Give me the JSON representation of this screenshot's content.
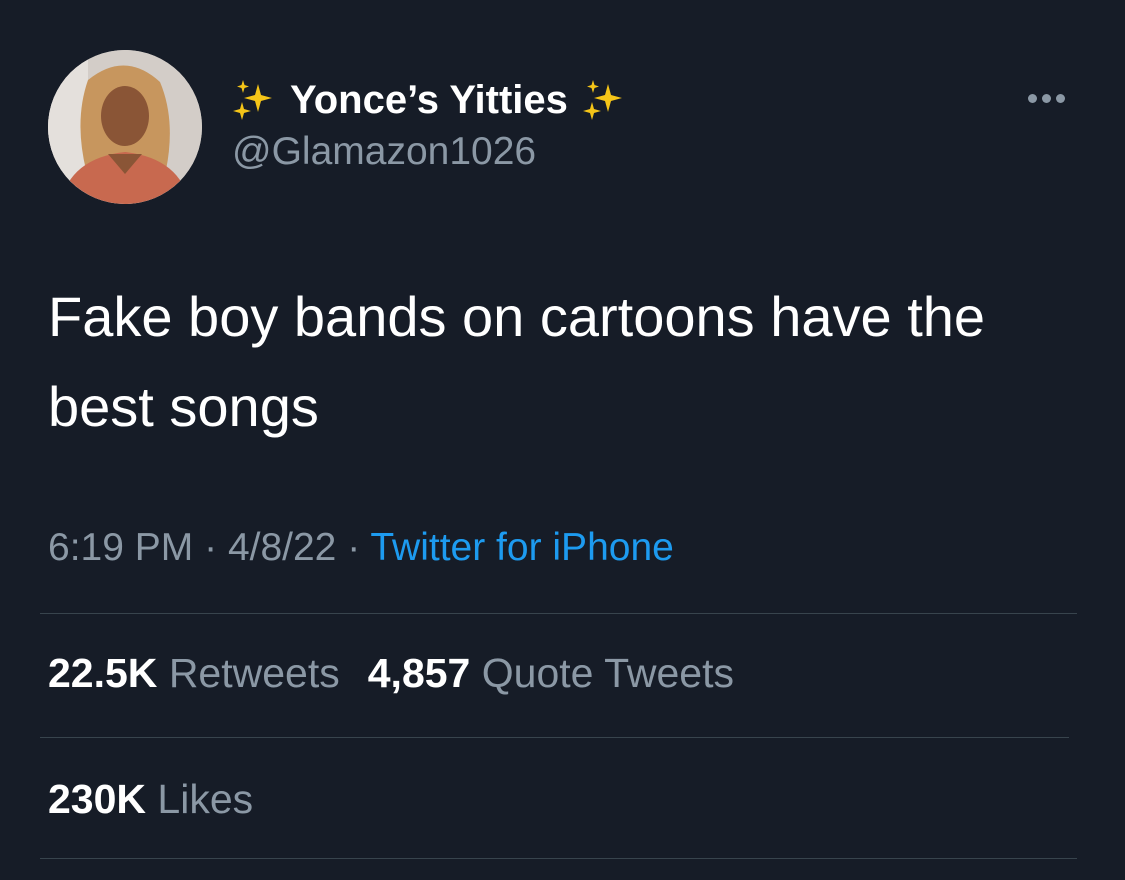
{
  "author": {
    "display_name": "Yonce’s Yitties",
    "handle": "@Glamazon1026",
    "avatar_icon": "profile-photo",
    "name_emoji": "sparkles-icon"
  },
  "tweet": {
    "text": "Fake boy bands on cartoons have the best songs",
    "time": "6:19 PM",
    "date": "4/8/22",
    "separator": "·",
    "source": "Twitter for iPhone"
  },
  "stats": {
    "retweets_count": "22.5K",
    "retweets_label": "Retweets",
    "quotes_count": "4,857",
    "quotes_label": "Quote Tweets",
    "likes_count": "230K",
    "likes_label": "Likes"
  },
  "colors": {
    "background": "#161c27",
    "text_primary": "#ffffff",
    "text_secondary": "#8b98a5",
    "link": "#1d9bf0",
    "divider": "#38444d"
  }
}
